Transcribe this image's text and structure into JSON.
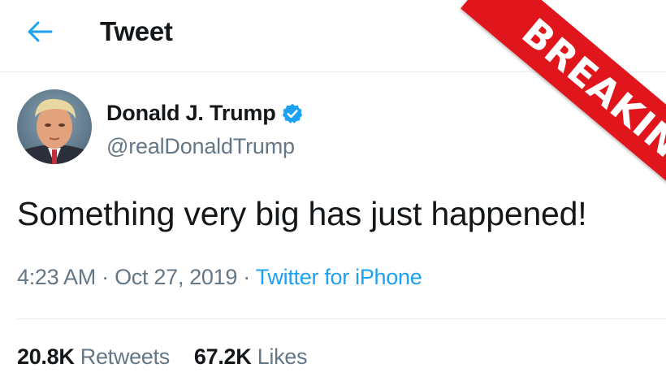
{
  "header": {
    "back_icon": "arrow-left-icon",
    "title": "Tweet"
  },
  "tweet": {
    "author": {
      "name": "Donald J. Trump",
      "verified": true,
      "verified_icon": "verified-badge-icon",
      "handle": "@realDonaldTrump",
      "avatar_icon": "profile-photo"
    },
    "text": "Something very big has just happened!",
    "time": "4:23 AM",
    "date": "Oct 27, 2019",
    "separator": "·",
    "source": "Twitter for iPhone",
    "stats": {
      "retweets_count": "20.8K",
      "retweets_label": "Retweets",
      "likes_count": "67.2K",
      "likes_label": "Likes"
    }
  },
  "overlay": {
    "banner_text": "BREAKING"
  },
  "colors": {
    "accent": "#1da1f2",
    "text_primary": "#14171a",
    "text_secondary": "#657786",
    "divider": "#e6ecf0",
    "banner": "#e1161c"
  }
}
